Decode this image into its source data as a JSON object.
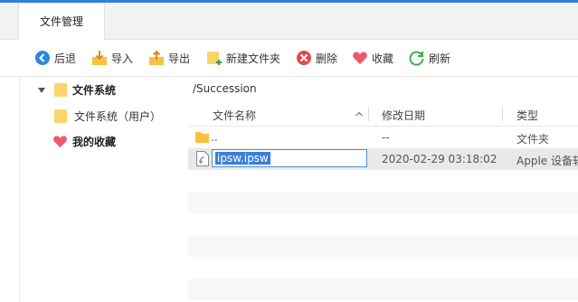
{
  "tab": {
    "label": "文件管理"
  },
  "toolbar": {
    "back": "后退",
    "import": "导入",
    "export": "导出",
    "new_folder": "新建文件夹",
    "delete": "删除",
    "favorite": "收藏",
    "refresh": "刷新"
  },
  "sidebar": {
    "filesystem": "文件系统",
    "filesystem_user": "文件系统（用户）",
    "favorites": "我的收藏"
  },
  "path": "/Succession",
  "columns": {
    "name": "文件名称",
    "date": "修改日期",
    "type": "类型"
  },
  "rows": [
    {
      "name": "..",
      "date": "--",
      "type": "文件夹"
    },
    {
      "name": "ipsw.ipsw",
      "date": "2020-02-29 03:18:02",
      "type": "Apple 设备软"
    }
  ],
  "colors": {
    "accent": "#2f7fe0",
    "folder": "#fcd469",
    "selection": "#3a7fd8"
  }
}
